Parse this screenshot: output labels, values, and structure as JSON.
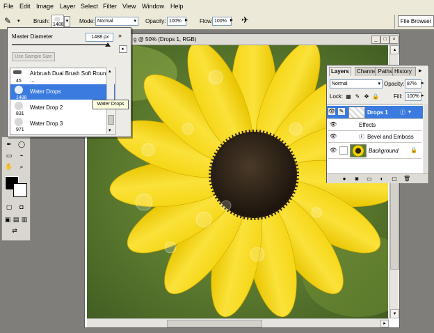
{
  "menu": [
    "File",
    "Edit",
    "Image",
    "Layer",
    "Select",
    "Filter",
    "View",
    "Window",
    "Help"
  ],
  "options": {
    "brush_label": "Brush:",
    "brush_size": "1488",
    "mode_label": "Mode:",
    "mode_value": "Normal",
    "opacity_label": "Opacity:",
    "opacity_value": "100%",
    "flow_label": "Flow:",
    "flow_value": "100%",
    "file_browser": "File Browser"
  },
  "document": {
    "title": "g @ 50% (Drops 1, RGB)"
  },
  "brush_picker": {
    "master_label": "Master Diameter",
    "master_value": "1488 px",
    "sample_button": "Use Sample Size",
    "items": [
      {
        "label": "Airbrush Dual Brush Soft Round ...",
        "size": "45"
      },
      {
        "label": "Water Drops",
        "size": "1488"
      },
      {
        "label": "Water Drop 2",
        "size": "831"
      },
      {
        "label": "Water Drop 3",
        "size": "971"
      }
    ],
    "tooltip": "Water Drops"
  },
  "layers_panel": {
    "tabs": [
      "Layers",
      "Channels",
      "History"
    ],
    "blend_mode": "Normal",
    "opacity_label": "Opacity:",
    "opacity_value": "87%",
    "lock_label": "Lock:",
    "fill_label": "Fill:",
    "fill_value": "100%",
    "rows": {
      "layer1": "Drops 1",
      "effects": "Effects",
      "bevel": "Bevel and Emboss",
      "background": "Background"
    }
  },
  "colors": {
    "highlight": "#2e6bd6",
    "selection_blue": "#3b7be0",
    "petal_yellow": "#f3d10a",
    "center_brown": "#2d2115"
  }
}
